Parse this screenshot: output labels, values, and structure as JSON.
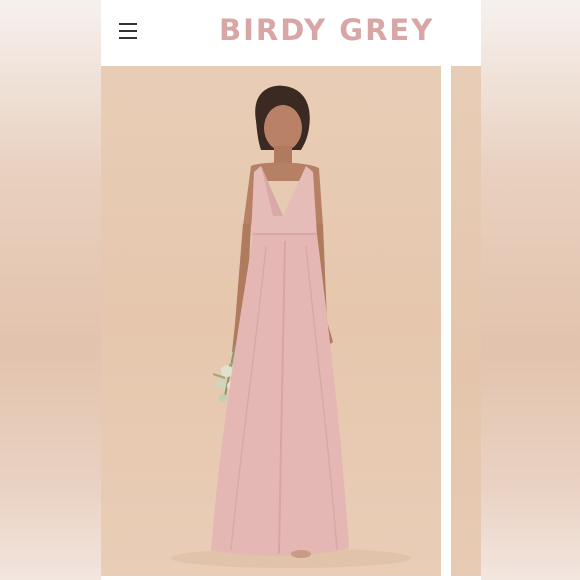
{
  "header": {
    "brand": "BIRDY GREY",
    "menu_icon": "hamburger-menu-icon"
  },
  "gallery": {
    "main_image": "product-photo",
    "next_image": "product-photo-peek"
  },
  "colors": {
    "brand": "#d9a6a6",
    "dress": "#e5b7b4",
    "backdrop": "#e8cdb6"
  }
}
